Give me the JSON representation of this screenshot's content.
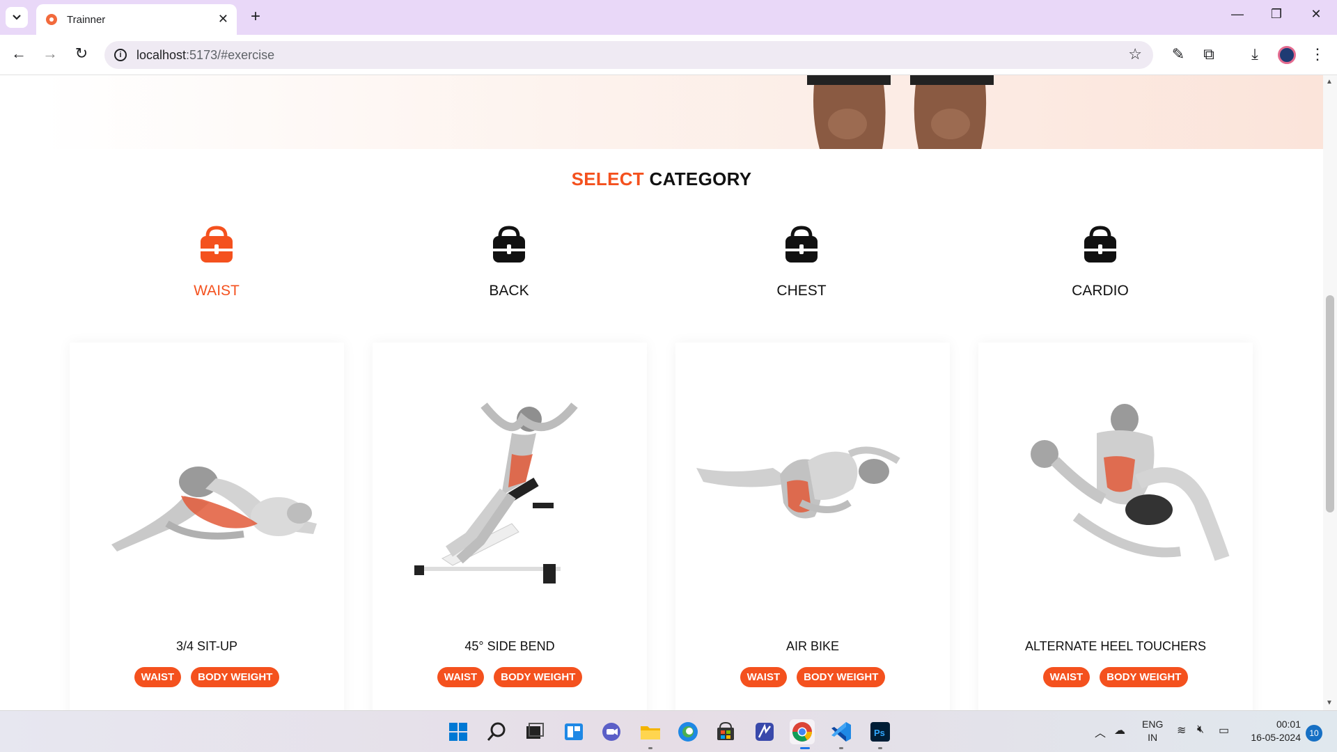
{
  "browser": {
    "tab_title": "Trainner",
    "url_host": "localhost",
    "url_path": ":5173/#exercise"
  },
  "page": {
    "title_accent": "SELECT",
    "title_rest": " CATEGORY",
    "categories": [
      {
        "label": "WAIST",
        "active": true
      },
      {
        "label": "BACK",
        "active": false
      },
      {
        "label": "CHEST",
        "active": false
      },
      {
        "label": "CARDIO",
        "active": false
      }
    ],
    "exercises": [
      {
        "name": "3/4 SIT-UP",
        "tags": [
          "WAIST",
          "BODY WEIGHT"
        ]
      },
      {
        "name": "45° SIDE BEND",
        "tags": [
          "WAIST",
          "BODY WEIGHT"
        ]
      },
      {
        "name": "AIR BIKE",
        "tags": [
          "WAIST",
          "BODY WEIGHT"
        ]
      },
      {
        "name": "ALTERNATE HEEL TOUCHERS",
        "tags": [
          "WAIST",
          "BODY WEIGHT"
        ]
      }
    ]
  },
  "taskbar": {
    "lang_line1": "ENG",
    "lang_line2": "IN",
    "time": "00:01",
    "date": "16-05-2024",
    "notifications": "10"
  },
  "colors": {
    "accent": "#f4511e",
    "chrome_tabbar": "#e9d8f8"
  }
}
